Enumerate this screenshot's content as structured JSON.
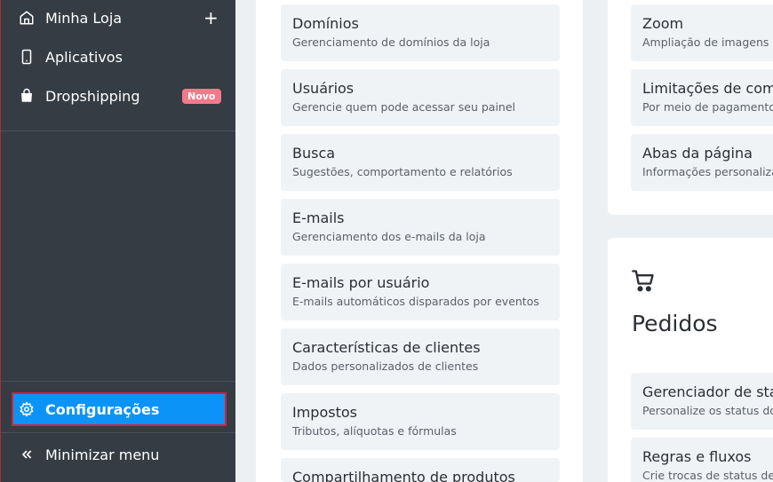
{
  "sidebar": {
    "items": [
      {
        "label": "Minha Loja",
        "icon": "store-icon",
        "action": "+"
      },
      {
        "label": "Aplicativos",
        "icon": "smartphone-icon"
      },
      {
        "label": "Dropshipping",
        "icon": "shopping-bag-icon",
        "badge": "Novo"
      }
    ],
    "config": {
      "label": "Configurações",
      "icon": "gear-icon"
    },
    "minimize": {
      "label": "Minimizar menu",
      "icon": "double-chevron-left-icon"
    }
  },
  "settings_column": {
    "cards": [
      {
        "title": "Domínios",
        "desc": "Gerenciamento de domínios da loja"
      },
      {
        "title": "Usuários",
        "desc": "Gerencie quem pode acessar seu painel"
      },
      {
        "title": "Busca",
        "desc": "Sugestões, comportamento e relatórios"
      },
      {
        "title": "E-mails",
        "desc": "Gerenciamento dos e-mails da loja"
      },
      {
        "title": "E-mails por usuário",
        "desc": "E-mails automáticos disparados por eventos"
      },
      {
        "title": "Características de clientes",
        "desc": "Dados personalizados de clientes"
      },
      {
        "title": "Impostos",
        "desc": "Tributos, alíquotas e fórmulas"
      },
      {
        "title": "Compartilhamento de produtos",
        "desc": ""
      }
    ]
  },
  "product_column": {
    "cards": [
      {
        "title": "Zoom",
        "desc": "Ampliação de imagens"
      },
      {
        "title": "Limitações de comp",
        "desc": "Por meio de pagamento o"
      },
      {
        "title": "Abas da página",
        "desc": "Informações personalizad"
      }
    ]
  },
  "orders_section": {
    "icon": "cart-icon",
    "title": "Pedidos",
    "cards": [
      {
        "title": "Gerenciador de sta",
        "desc": "Personalize os status dos"
      },
      {
        "title": "Regras e fluxos",
        "desc": "Crie trocas de status de f"
      }
    ]
  },
  "colors": {
    "sidebar_bg": "#363c44",
    "active_item_bg": "#0b93f8",
    "highlight_outline": "#d1243a",
    "badge_bg": "#f27a8a",
    "card_bg": "#f0f3f6"
  }
}
